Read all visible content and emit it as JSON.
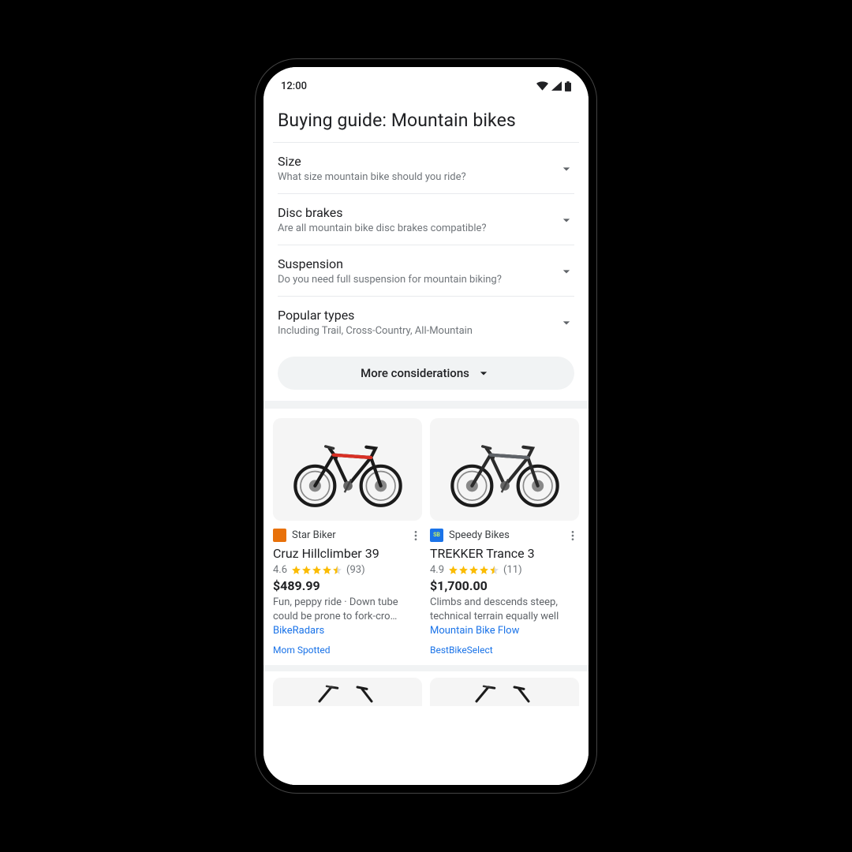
{
  "status": {
    "time": "12:00"
  },
  "page": {
    "title": "Buying guide: Mountain bikes"
  },
  "accordion": [
    {
      "title": "Size",
      "sub": "What size mountain bike should you ride?"
    },
    {
      "title": "Disc brakes",
      "sub": "Are all mountain bike disc brakes compatible?"
    },
    {
      "title": "Suspension",
      "sub": "Do you need full suspension for mountain biking?"
    },
    {
      "title": "Popular types",
      "sub": "Including Trail, Cross-Country, All-Mountain"
    }
  ],
  "more_button": "More considerations",
  "products": [
    {
      "seller": "Star Biker",
      "seller_color": "#e8710a",
      "name": "Cruz Hillclimber 39",
      "rating": "4.6",
      "stars": 4.5,
      "review_count": "(93)",
      "price": "$489.99",
      "desc": "Fun, peppy ride · Down tube could be prone to fork-cro…",
      "source1": "BikeRadars",
      "source2": "Mom Spotted",
      "accent": "#d93025"
    },
    {
      "seller": "Speedy Bikes",
      "seller_color": "#1a73e8",
      "name": "TREKKER Trance 3",
      "rating": "4.9",
      "stars": 4.5,
      "review_count": "(11)",
      "price": "$1,700.00",
      "desc": "Climbs and descends steep, technical terrain equally well",
      "source1": "Mountain Bike Flow",
      "source2": "BestBikeSelect",
      "accent": "#5f6368"
    }
  ]
}
